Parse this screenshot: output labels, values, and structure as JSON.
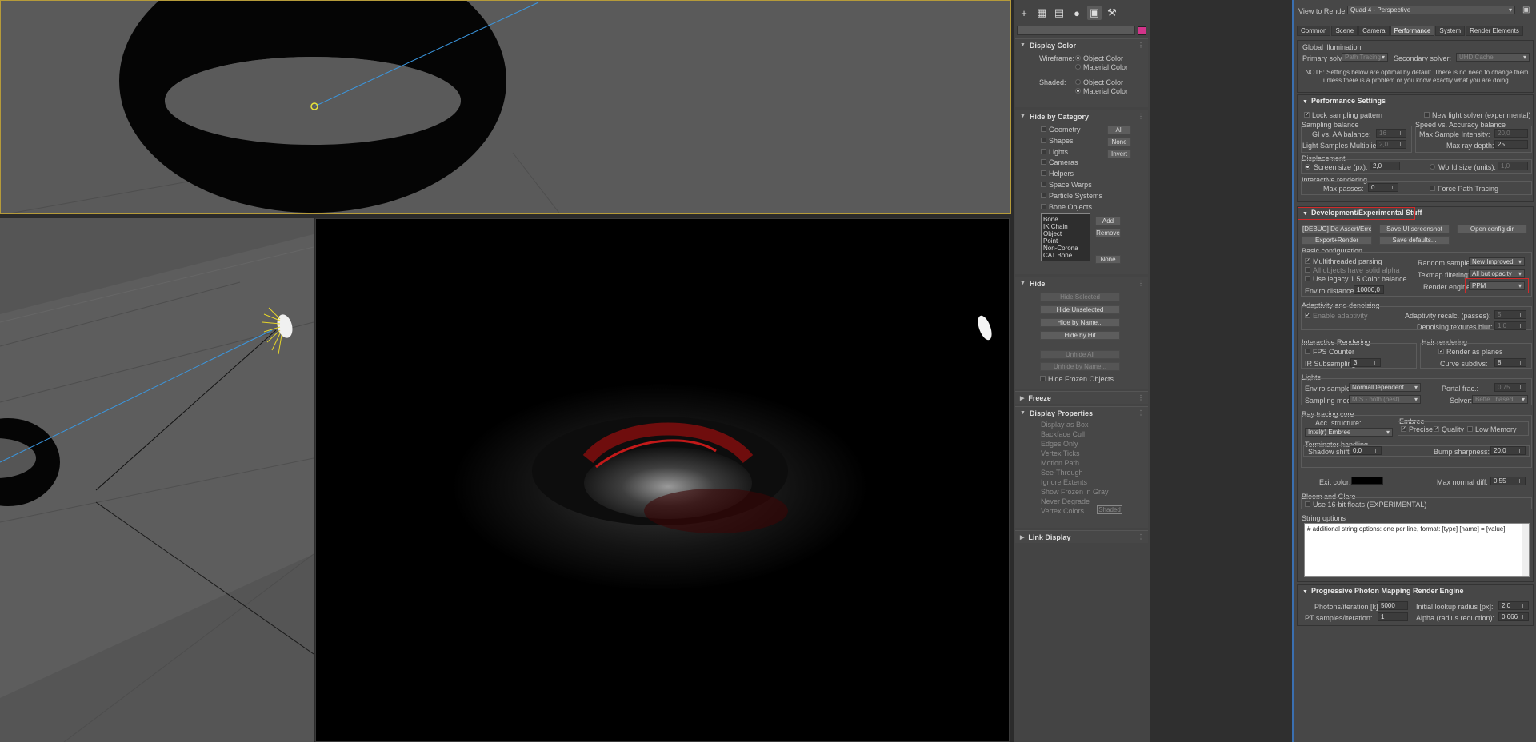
{
  "viewports": {
    "top_label": "",
    "left_label": "",
    "render_label": ""
  },
  "command_panel": {
    "toolbar_icons": [
      "create-icon",
      "modify-icon",
      "hierarchy-icon",
      "motion-icon",
      "display-icon",
      "utilities-icon"
    ],
    "display_color": {
      "title": "Display Color",
      "wireframe_label": "Wireframe:",
      "shaded_label": "Shaded:",
      "object_color": "Object Color",
      "material_color": "Material Color"
    },
    "hide_by_category": {
      "title": "Hide by Category",
      "items": [
        "Geometry",
        "Shapes",
        "Lights",
        "Cameras",
        "Helpers",
        "Space Warps",
        "Particle Systems",
        "Bone Objects"
      ],
      "buttons": [
        "All",
        "None",
        "Invert"
      ],
      "list": [
        "Bone",
        "IK Chain Object",
        "Point",
        "Non-Corona",
        "CAT Bone"
      ],
      "add": "Add",
      "remove": "Remove",
      "none2": "None"
    },
    "hide": {
      "title": "Hide",
      "buttons": [
        "Hide Selected",
        "Hide Unselected",
        "Hide by Name...",
        "Hide by Hit",
        "Unhide All",
        "Unhide by Name..."
      ],
      "frozen": "Hide Frozen Objects"
    },
    "freeze": {
      "title": "Freeze"
    },
    "display_properties": {
      "title": "Display Properties",
      "items": [
        "Display as Box",
        "Backface Cull",
        "Edges Only",
        "Vertex Ticks",
        "Motion Path",
        "See-Through",
        "Ignore Extents",
        "Show Frozen in Gray",
        "Never Degrade",
        "Vertex Colors"
      ],
      "shaded": "Shaded"
    },
    "link_display": {
      "title": "Link Display"
    }
  },
  "render_setup": {
    "view_to_render_label": "View to Render:",
    "view_to_render_value": "Quad 4 - Perspective",
    "tabs": [
      "Common",
      "Scene",
      "Camera",
      "Performance",
      "System",
      "Render Elements"
    ],
    "gi": {
      "title": "Global illumination",
      "primary_label": "Primary solver:",
      "primary_value": "Path Tracing",
      "secondary_label": "Secondary solver:",
      "secondary_value": "UHD Cache",
      "note": "NOTE: Settings below are optimal by default. There is no need to change them unless there is a problem or you know exactly what you are doing."
    },
    "perf": {
      "title": "Performance Settings",
      "lock": "Lock sampling pattern",
      "new_light": "New light solver (experimental)",
      "sampling_balance": "Sampling balance",
      "speed_acc": "Speed vs. Accuracy balance",
      "gi_aa": "GI vs. AA balance:",
      "gi_aa_val": "16",
      "light_mult": "Light Samples Multiplier:",
      "light_mult_val": "2,0",
      "max_int": "Max Sample Intensity:",
      "max_int_val": "20,0",
      "max_depth": "Max ray depth:",
      "max_depth_val": "25",
      "displacement": "Displacement",
      "screen_size": "Screen size (px):",
      "screen_size_val": "2,0",
      "world_size": "World size (units):",
      "world_size_val": "1,0",
      "interactive": "Interactive rendering",
      "max_passes": "Max passes:",
      "max_passes_val": "0",
      "force_pt": "Force Path Tracing"
    },
    "dev": {
      "title": "Development/Experimental Stuff",
      "btn_debug": "[DEBUG] Do Assert/Error",
      "btn_save_ui": "Save UI screenshot",
      "btn_open_cfg": "Open config dir",
      "btn_export": "Export+Render",
      "btn_save_def": "Save defaults...",
      "basic": "Basic configuration",
      "multithreaded": "Multithreaded parsing",
      "all_objects": "All objects have solid alpha",
      "legacy": "Use legacy 1.5 Color balance",
      "enviro_dist": "Enviro distance:",
      "enviro_dist_val": "10000,0",
      "random_sampler": "Random sampler:",
      "random_sampler_val": "New Improved",
      "texmap": "Texmap filtering:",
      "texmap_val": "All but opacity",
      "render_engine": "Render engine:",
      "render_engine_val": "PPM",
      "adaptivity": "Adaptivity and denoising",
      "enable_adapt": "Enable adaptivity",
      "adapt_recalc": "Adaptivity recalc. (passes):",
      "adapt_recalc_val": "5",
      "denoise_blur": "Denoising textures blur:",
      "denoise_blur_val": "1,0",
      "ir": "Interactive Rendering",
      "fps": "FPS Counter",
      "ir_sub": "IR Subsampling:",
      "ir_sub_val": "3",
      "hair": "Hair rendering",
      "render_planes": "Render as planes",
      "curve_subdiv": "Curve subdivs:",
      "curve_subdiv_val": "8",
      "lights": "Lights",
      "enviro_sampler": "Enviro sampler:",
      "enviro_sampler_val": "NormalDependent",
      "portal": "Portal frac.:",
      "portal_val": "0,75",
      "sampling_mode": "Sampling mode:",
      "sampling_mode_val": "MIS - both (best)",
      "solver": "Solver:",
      "solver_val": "Bette...based",
      "rt_core": "Ray tracing core",
      "acc": "Acc. structure:",
      "acc_val": "Intel(r) Embree",
      "embree": "Embree",
      "precise": "Precise",
      "quality": "Quality",
      "low_mem": "Low Memory",
      "terminator": "Terminator handling",
      "shadow_shift": "Shadow shift:",
      "shadow_shift_val": "0,0",
      "bump_sharp": "Bump sharpness:",
      "bump_sharp_val": "20,0",
      "exit_color": "Exit color:",
      "max_normal": "Max normal diff:",
      "max_normal_val": "0,55",
      "bloom": "Bloom and Glare",
      "use16": "Use 16-bit floats (EXPERIMENTAL)",
      "string_opts": "String options",
      "string_text": "# additional string options: one per line, format: [type] [name] = [value]"
    },
    "ppm": {
      "title": "Progressive Photon Mapping Render Engine",
      "photons": "Photons/iteration [k]:",
      "photons_val": "5000",
      "pt_samples": "PT samples/iteration:",
      "pt_samples_val": "1",
      "init_radius": "Initial lookup radius [px]:",
      "init_radius_val": "2,0",
      "alpha": "Alpha (radius reduction):",
      "alpha_val": "0,666"
    }
  },
  "colors": {
    "accent": "#3a6fb0",
    "highlight": "#d12a2a",
    "swatch": "#d2348a"
  }
}
